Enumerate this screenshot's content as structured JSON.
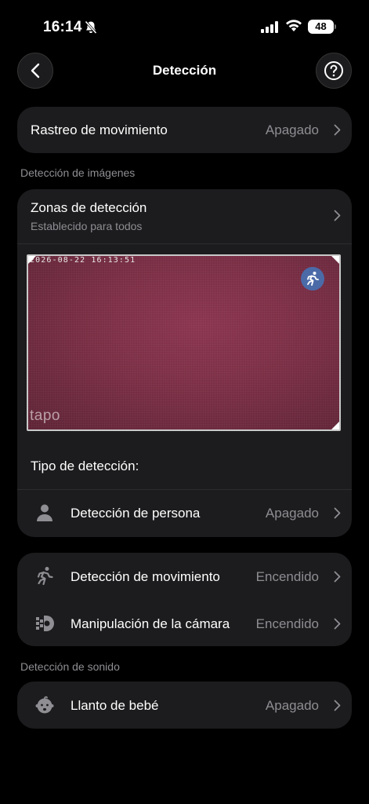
{
  "status": {
    "time": "16:14",
    "battery": "48"
  },
  "header": {
    "title": "Detección"
  },
  "motion_tracking": {
    "label": "Rastreo de movimiento",
    "value": "Apagado"
  },
  "image_detection": {
    "section_label": "Detección de imágenes",
    "zones": {
      "label": "Zonas de detección",
      "sub": "Establecido para todos"
    },
    "preview": {
      "timestamp": "2026-08-22  16:13:51",
      "logo": "tapo"
    },
    "type_label": "Tipo de detección:",
    "person": {
      "label": "Detección de persona",
      "value": "Apagado"
    }
  },
  "other_detection": {
    "motion": {
      "label": "Detección de movimiento",
      "value": "Encendido"
    },
    "tamper": {
      "label": "Manipulación de la cámara",
      "value": "Encendido"
    }
  },
  "sound_detection": {
    "section_label": "Detección de sonido",
    "baby_cry": {
      "label": "Llanto de bebé",
      "value": "Apagado"
    }
  },
  "colors": {
    "background": "#000000",
    "card": "#1c1c1e",
    "secondary_text": "#8e8e93",
    "preview_tint": "#7a2e45",
    "badge": "#4b6aa8"
  }
}
